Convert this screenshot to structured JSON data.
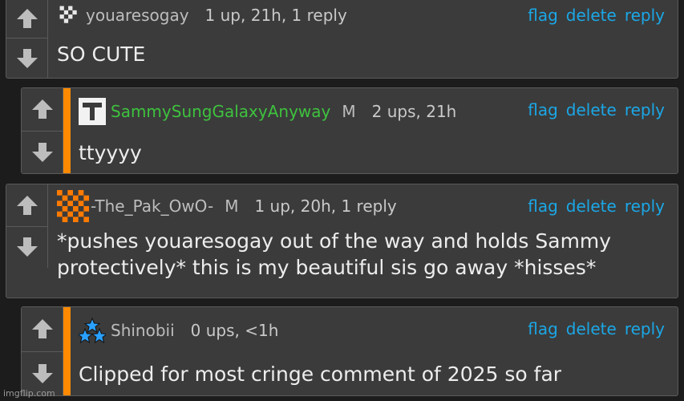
{
  "actions": {
    "flag": "flag",
    "delete": "delete",
    "reply": "reply"
  },
  "comments": [
    {
      "username": "youaresogay",
      "meta": "1 up, 21h, 1 reply",
      "text": "SO CUTE",
      "avatar": "pixel-dots-avatar"
    },
    {
      "username": "SammySungGalaxyAnyway",
      "badge": "M",
      "meta": "2 ups, 21h",
      "text": "ttyyyy",
      "avatar": "letter-t-avatar",
      "username_color": "#3ec23e"
    },
    {
      "username": "-The_Pak_OwO-",
      "badge": "M",
      "meta": "1 up, 20h, 1 reply",
      "text": "*pushes youaresogay out of the way and holds Sammy protectively* this is my beautiful sis go away *hisses*",
      "avatar": "orange-checker-avatar"
    },
    {
      "username": "Shinobii",
      "meta": "0 ups, <1h",
      "text": "Clipped for most cringe comment of 2025 so far",
      "avatar": "blue-stars-avatar"
    }
  ],
  "colors": {
    "accent_bar": "#ff8a00",
    "link": "#1ba7e6",
    "panel": "#3b3b3b",
    "background": "#1c1c1c"
  },
  "watermark": "imgflip.com"
}
